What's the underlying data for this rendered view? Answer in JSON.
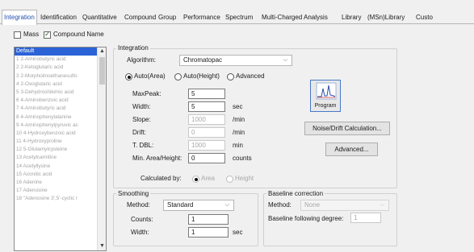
{
  "tabs": [
    "Integration",
    "Identification",
    "Quantitative",
    "Compound",
    "Group",
    "Performance",
    "Spectrum",
    "Multi-Charged Analysis",
    "Library",
    "(MSn)Library",
    "Custo"
  ],
  "filters": {
    "mass_label": "Mass",
    "mass_checked": false,
    "compound_name_label": "Compound Name",
    "compound_name_checked": true
  },
  "compound_list": {
    "items": [
      "Default",
      "1 2-Aminobutyric acid",
      "2 2-Ketoglutaric acid",
      "3 2-Morpholinoethanesulfo",
      "4 2-Oxoglutaric acid",
      "5 3-Dehydroshikimic acid",
      "6 4-Aminobenzoic acid",
      "7 4-Aminobutyric acid",
      "8 4-Aminophenylalanine",
      "9 4-Aminophenylpyruvic ac",
      "10 4-Hydroxybenzoic acid",
      "11 4-Hydroxyproline",
      "12 5-Glutamylcysteine",
      "13 Acetylcarnitine",
      "14 Acetyllysine",
      "15 Aconitic acid",
      "16 Adenine",
      "17 Adenosine",
      "18 \"Adenosine 3',5'-cyclic r"
    ],
    "selected_index": 0
  },
  "integration": {
    "group_title": "Integration",
    "algorithm_label": "Algorithm:",
    "algorithm_value": "Chromatopac",
    "modes": [
      "Auto(Area)",
      "Auto(Height)",
      "Advanced"
    ],
    "mode_selected": 0,
    "params": [
      {
        "label": "MaxPeak:",
        "value": "5",
        "unit": "",
        "enabled": true
      },
      {
        "label": "Width:",
        "value": "5",
        "unit": "sec",
        "enabled": true
      },
      {
        "label": "Slope:",
        "value": "1000",
        "unit": "/min",
        "enabled": false
      },
      {
        "label": "Drift:",
        "value": "0",
        "unit": "/min",
        "enabled": false
      },
      {
        "label": "T. DBL:",
        "value": "1000",
        "unit": "min",
        "enabled": false
      },
      {
        "label": "Min. Area/Height:",
        "value": "0",
        "unit": "counts",
        "enabled": true
      }
    ],
    "calculated_by_label": "Calculated by:",
    "calculated_by_options": [
      "Area",
      "Height"
    ],
    "program_label": "Program",
    "noise_drift_label": "Noise/Drift Calculation...",
    "advanced_label": "Advanced..."
  },
  "smoothing": {
    "group_title": "Smoothing",
    "method_label": "Method:",
    "method_value": "Standard",
    "counts_label": "Counts:",
    "counts_value": "1",
    "width_label": "Width:",
    "width_value": "1",
    "width_unit": "sec"
  },
  "baseline": {
    "group_title": "Baseline correction",
    "method_label": "Method:",
    "method_value": "None",
    "degree_label": "Baseline following degree:",
    "degree_value": "1"
  },
  "colors": {
    "accent": "#2b63d6",
    "tab_active_text": "#1f4fb0",
    "disabled_text": "#a8a8a8"
  }
}
